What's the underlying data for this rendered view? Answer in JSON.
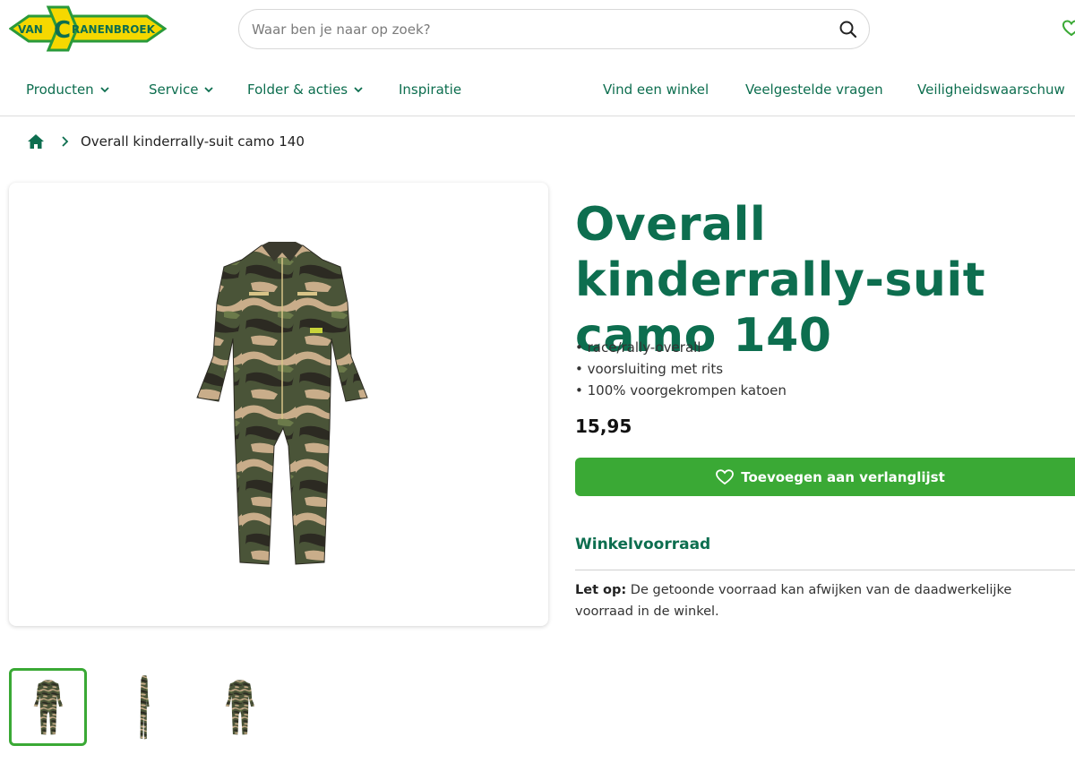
{
  "header": {
    "logo_text": "VANCRANENBROEK",
    "search_placeholder": "Waar ben je naar op zoek?"
  },
  "nav": {
    "items": [
      {
        "label": "Producten",
        "has_dropdown": true
      },
      {
        "label": "Service",
        "has_dropdown": true
      },
      {
        "label": "Folder & acties",
        "has_dropdown": true
      },
      {
        "label": "Inspiratie",
        "has_dropdown": false
      }
    ],
    "right_items": [
      {
        "label": "Vind een winkel"
      },
      {
        "label": "Veelgestelde vragen"
      },
      {
        "label": "Veiligheidswaarschuw"
      }
    ]
  },
  "breadcrumb": {
    "current": "Overall kinderrally-suit camo 140"
  },
  "product": {
    "title": "Overall kinderrally-suit camo 140",
    "bullets": [
      "• race/rally-overall",
      "• voorsluiting met rits",
      "• 100% voorgekrompen katoen"
    ],
    "price": "15,95",
    "wishlist_label": "Toevoegen aan verlanglijst",
    "stock_title": "Winkelvoorraad",
    "note_label": "Let op:",
    "note_text": " De getoonde voorraad kan afwijken van de daadwerkelijke voorraad in de winkel."
  },
  "gallery": {
    "thumbnail_count": 3,
    "active_index": 0
  },
  "colors": {
    "brand_green": "#0d6e4f",
    "button_green": "#3aa935",
    "logo_yellow": "#f5d800"
  }
}
